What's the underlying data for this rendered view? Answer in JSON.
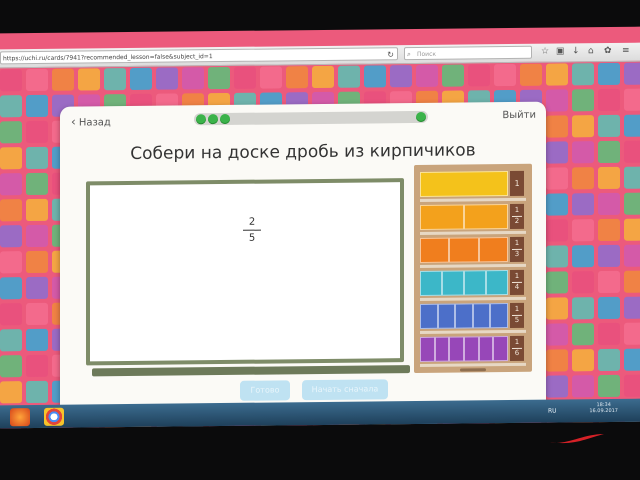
{
  "browser": {
    "url": "https://uchi.ru/cards/7941?recommended_lesson=false&subject_id=1",
    "search_placeholder": "Поиск"
  },
  "nav": {
    "back_label": "Назад",
    "exit_label": "Выйти",
    "progress_completed": 3,
    "progress_total": 4
  },
  "task": {
    "title": "Собери на доске дробь из кирпичиков",
    "fraction": {
      "numerator": "2",
      "denominator": "5"
    }
  },
  "shelf": {
    "rows": [
      {
        "label_num": "1",
        "label_den": "",
        "color": "#f4c21b",
        "pieces": 1
      },
      {
        "label_num": "1",
        "label_den": "2",
        "color": "#f3a11c",
        "pieces": 2
      },
      {
        "label_num": "1",
        "label_den": "3",
        "color": "#f07e1e",
        "pieces": 3
      },
      {
        "label_num": "1",
        "label_den": "4",
        "color": "#3cb7c8",
        "pieces": 4
      },
      {
        "label_num": "1",
        "label_den": "5",
        "color": "#4c6fc9",
        "pieces": 5
      },
      {
        "label_num": "1",
        "label_den": "6",
        "color": "#9747b8",
        "pieces": 6
      }
    ]
  },
  "buttons": {
    "check_label": "Готово",
    "hint_label": "Начать сначала"
  },
  "taskbar": {
    "lang": "RU",
    "time": "18:34",
    "date": "16.09.2017"
  }
}
